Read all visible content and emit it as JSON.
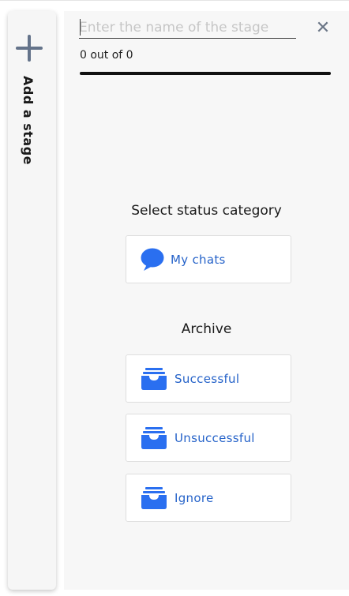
{
  "add_stage": {
    "label": "Add a stage",
    "icon": "plus-icon"
  },
  "stage_editor": {
    "name_placeholder": "Enter the name of the stage",
    "name_value": "",
    "count_text": "0 out of 0",
    "progress_fraction": 1.0,
    "close_icon": "close-icon"
  },
  "status_section": {
    "title": "Select status category",
    "items": [
      {
        "label": "My chats",
        "icon": "chat-bubble-icon"
      }
    ]
  },
  "archive_section": {
    "title": "Archive",
    "items": [
      {
        "label": "Successful",
        "icon": "inbox-tray-icon"
      },
      {
        "label": "Unsuccessful",
        "icon": "inbox-tray-icon"
      },
      {
        "label": "Ignore",
        "icon": "inbox-tray-icon"
      }
    ]
  },
  "colors": {
    "accent": "#2663c9",
    "icon_blue": "#2a6ff0",
    "panel_bg": "#f7f7f7",
    "plus_icon": "#64738a"
  }
}
